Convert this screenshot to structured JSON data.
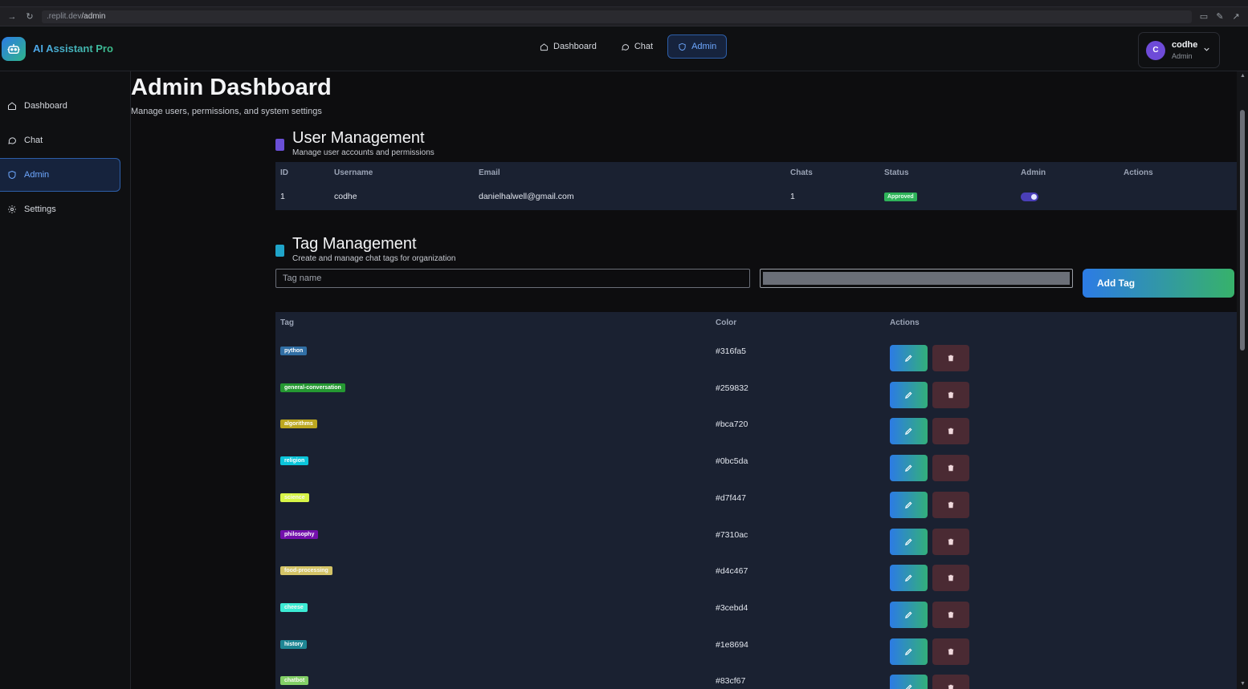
{
  "browser": {
    "url_host": ".replit.dev",
    "url_path": "/admin"
  },
  "app": {
    "name": "AI Assistant Pro"
  },
  "topnav": [
    {
      "label": "Dashboard",
      "icon": "home-icon"
    },
    {
      "label": "Chat",
      "icon": "chat-icon"
    },
    {
      "label": "Admin",
      "icon": "shield-icon"
    }
  ],
  "user": {
    "initial": "C",
    "name": "codhe",
    "role": "Admin"
  },
  "sidebar": [
    {
      "label": "Dashboard",
      "icon": "home-icon"
    },
    {
      "label": "Chat",
      "icon": "chat-icon"
    },
    {
      "label": "Admin",
      "icon": "shield-icon"
    },
    {
      "label": "Settings",
      "icon": "gear-icon"
    }
  ],
  "page": {
    "title": "Admin Dashboard",
    "subtitle": "Manage users, permissions, and system settings"
  },
  "users_section": {
    "title": "User Management",
    "subtitle": "Manage user accounts and permissions",
    "headers": {
      "id": "ID",
      "username": "Username",
      "email": "Email",
      "chats": "Chats",
      "status": "Status",
      "admin": "Admin",
      "actions": "Actions"
    },
    "rows": [
      {
        "id": "1",
        "username": "codhe",
        "email": "danielhalwell@gmail.com",
        "chats": "1",
        "status": "Approved",
        "admin": true
      }
    ]
  },
  "tags_section": {
    "title": "Tag Management",
    "subtitle": "Create and manage chat tags for organization",
    "name_placeholder": "Tag name",
    "add_label": "Add Tag",
    "headers": {
      "tag": "Tag",
      "color": "Color",
      "actions": "Actions"
    },
    "rows": [
      {
        "name": "python",
        "color": "#316fa5"
      },
      {
        "name": "general-conversation",
        "color": "#259832"
      },
      {
        "name": "algorithms",
        "color": "#bca720"
      },
      {
        "name": "religion",
        "color": "#0bc5da"
      },
      {
        "name": "science",
        "color": "#d7f447"
      },
      {
        "name": "philosophy",
        "color": "#7310ac"
      },
      {
        "name": "food-processing",
        "color": "#d4c467"
      },
      {
        "name": "cheese",
        "color": "#3cebd4"
      },
      {
        "name": "history",
        "color": "#1e8694"
      },
      {
        "name": "chatbot",
        "color": "#83cf67"
      }
    ]
  },
  "colors": {
    "accent": "#2c7be5",
    "accent2": "#37b26a",
    "panel": "#1a2131"
  }
}
